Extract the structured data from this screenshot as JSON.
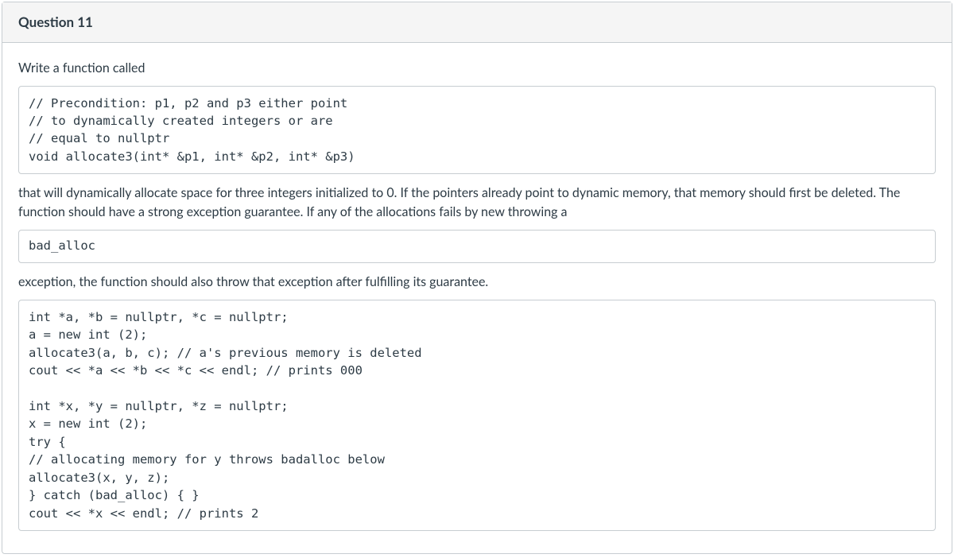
{
  "header": {
    "title": "Question 11"
  },
  "body": {
    "intro": "Write a function called",
    "code1": "// Precondition: p1, p2 and p3 either point\n// to dynamically created integers or are\n// equal to nullptr\nvoid allocate3(int* &p1, int* &p2, int* &p3)",
    "para1": "that will dynamically allocate space for three integers initialized to 0. If the pointers already point to dynamic memory, that memory should first be deleted. The function should have a strong exception guarantee. If any of the allocations fails by new throwing a",
    "code2": "bad_alloc",
    "para2": "exception, the function should also throw that exception after fulfilling its guarantee.",
    "code3": "int *a, *b = nullptr, *c = nullptr;\na = new int (2);\nallocate3(a, b, c); // a's previous memory is deleted\ncout << *a << *b << *c << endl; // prints 000\n\nint *x, *y = nullptr, *z = nullptr;\nx = new int (2);\ntry {\n// allocating memory for y throws badalloc below\nallocate3(x, y, z);\n} catch (bad_alloc) { }\ncout << *x << endl; // prints 2"
  }
}
